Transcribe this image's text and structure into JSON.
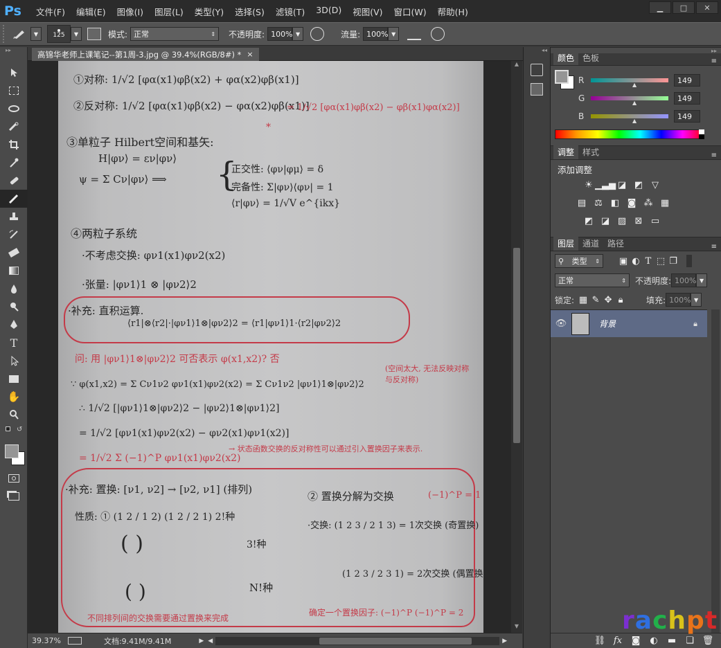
{
  "app": {
    "logo": "Ps"
  },
  "menu": [
    "文件(F)",
    "编辑(E)",
    "图像(I)",
    "图层(L)",
    "类型(Y)",
    "选择(S)",
    "滤镜(T)",
    "3D(D)",
    "视图(V)",
    "窗口(W)",
    "帮助(H)"
  ],
  "window_buttons": [
    "▁",
    "□",
    "✕"
  ],
  "options": {
    "brush_size": "125",
    "mode_label": "模式:",
    "mode_value": "正常",
    "opacity_label": "不透明度:",
    "opacity_value": "100%",
    "flow_label": "流量:",
    "flow_value": "100%"
  },
  "document": {
    "tab_title": "高锦华老师上课笔记--第1周-3.jpg @ 39.4%(RGB/8#) *",
    "close": "×"
  },
  "status": {
    "zoom": "39.37%",
    "doc_info": "文档:9.41M/9.41M"
  },
  "color_panel": {
    "tabs": [
      "颜色",
      "色板"
    ],
    "r_label": "R",
    "g_label": "G",
    "b_label": "B",
    "r": "149",
    "g": "149",
    "b": "149",
    "fg_color": "#959595"
  },
  "adjust_panel": {
    "tabs": [
      "调整",
      "样式"
    ],
    "heading": "添加调整"
  },
  "layers_panel": {
    "tabs": [
      "图层",
      "通道",
      "路径"
    ],
    "filter_label": "类型",
    "blend_mode": "正常",
    "opacity_label": "不透明度:",
    "opacity_value": "100%",
    "lock_label": "锁定:",
    "fill_label": "填充:",
    "fill_value": "100%",
    "layer_name": "背景"
  },
  "watermark": "rachpt",
  "notes": {
    "l1": "①对称: 1/√2 [φα(x1)φβ(x2) + φα(x2)φβ(x1)]",
    "l2": "②反对称: 1/√2 [φα(x1)φβ(x2) − φα(x2)φβ(x1)]",
    "l2r": "= 1/√2 [φα(x1)φβ(x2) − φβ(x1)φα(x2)]",
    "l3": "③单粒子 Hilbert空间和基矢:",
    "l4": "H|φν⟩ = εν|φν⟩",
    "l5a": "正交性: ⟨φν|φμ⟩ = δ",
    "l5b": "完备性: Σ|φν⟩⟨φν| = 1",
    "l5c": "⟨r|φν⟩ = 1/√V e^{ikx}",
    "l5d": "ψ = Σ Cν|φν⟩  ⟹",
    "l6": "④两粒子系统",
    "l7": "·不考虑交换: φν1(x1)φν2(x2)",
    "l8": "·张量: |φν1⟩1 ⊗ |φν2⟩2",
    "l9": "·补充: 直积运算.",
    "l10": "⟨r1|⊗⟨r2|·|φν1⟩1⊗|φν2⟩2 = ⟨r1|φν1⟩1·⟨r2|φν2⟩2",
    "l11": "问: 用 |φν1⟩1⊗|φν2⟩2 可否表示 φ(x1,x2)? 否",
    "l12": "∵ φ(x1,x2) = Σ Cν1ν2 φν1(x1)φν2(x2) = Σ Cν1ν2 |φν1⟩1⊗|φν2⟩2",
    "l12r": "(空间太大, 无法反映对称与反对称)",
    "l13": "∴ 1/√2 [|φν1⟩1⊗|φν2⟩2 − |φν2⟩1⊗|φν1⟩2]",
    "l14": "= 1/√2 [φν1(x1)φν2(x2) − φν2(x1)φν1(x2)]",
    "l15": "= 1/√2 Σ (−1)^P φν1(x1)φν2(x2)",
    "l15r": "→ 状态函数交换的反对称性可以通过引入置换因子来表示.",
    "l16": "·补充: 置换: [ν1, ν2] → [ν2, ν1]  (排列)",
    "l17": "性质: ① (1 2 / 1 2)  (1 2 / 2 1)     2!种",
    "l18": "② 置换分解为交换",
    "l19": "·交换: (1 2 3 / 2 1 3) = 1次交换 (奇置换)",
    "l20": "(−1)^P = 1",
    "l21": "(1 2 3 / 2 3 1) = 2次交换 (偶置换)",
    "l22": "3!种",
    "l23": "N!种",
    "l24": "不同排列间的交换需要通过置换来完成",
    "l25": "确定一个置换因子: (−1)^P   (−1)^P = 2"
  }
}
